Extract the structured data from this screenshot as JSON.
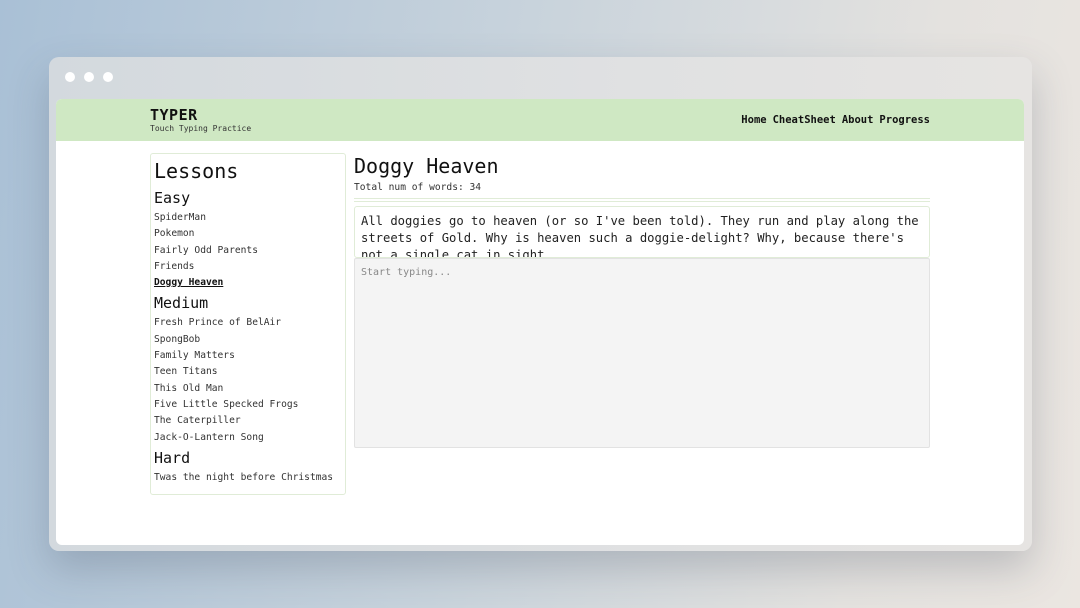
{
  "header": {
    "logo_title": "TYPER",
    "logo_subtitle": "Touch Typing Practice",
    "nav": [
      "Home",
      "CheatSheet",
      "About",
      "Progress"
    ]
  },
  "sidebar": {
    "title": "Lessons",
    "groups": [
      {
        "label": "Easy",
        "items": [
          "SpiderMan",
          "Pokemon",
          "Fairly Odd Parents",
          "Friends",
          "Doggy Heaven"
        ]
      },
      {
        "label": "Medium",
        "items": [
          "Fresh Prince of BelAir",
          "SpongBob",
          "Family Matters",
          "Teen Titans",
          "This Old Man",
          "Five Little Specked Frogs",
          "The Caterpiller",
          "Jack-O-Lantern Song"
        ]
      },
      {
        "label": "Hard",
        "items": [
          "Twas the night before Christmas"
        ]
      }
    ],
    "active_item": "Doggy Heaven"
  },
  "lesson": {
    "title": "Doggy Heaven",
    "word_count": "Total num of words: 34",
    "passage": "All doggies go to heaven (or so I've been told). They run and play along the streets of Gold. Why is heaven such a doggie-delight? Why, because there's not a single cat in sight."
  },
  "typing": {
    "placeholder": "Start typing..."
  },
  "colors": {
    "header_bg": "#cfe8c3",
    "panel_border": "#e0ecd7",
    "typing_bg": "#f4f4f4"
  }
}
